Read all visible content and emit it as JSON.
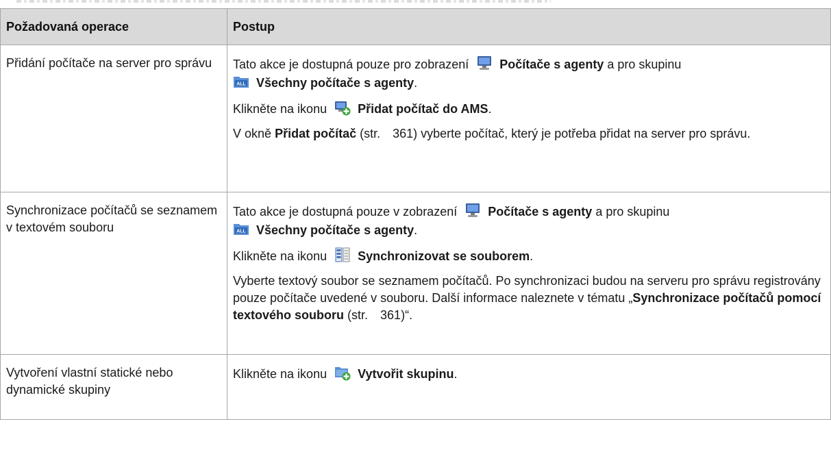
{
  "table": {
    "headers": [
      "Požadovaná operace",
      "Postup"
    ],
    "rows": [
      {
        "operation": "Přidání počítače na server pro správu",
        "p1": {
          "t1": "Tato akce je dostupná pouze pro zobrazení",
          "b1": "Počítače s agenty",
          "t2": "a pro skupinu",
          "b2": "Všechny počítače s agenty",
          "t3": ".",
          "icon1": "computer-icon",
          "icon2": "all-group-folder-icon"
        },
        "p2": {
          "t1": "Klikněte na ikonu",
          "b1": "Přidat počítač do AMS",
          "t2": ".",
          "icon": "add-computer-icon"
        },
        "p3": {
          "t1": "V okně",
          "b1": "Přidat počítač",
          "t2": "(str.",
          "page": "361",
          "t3": ") vyberte počítač, který je potřeba přidat na server pro správu."
        }
      },
      {
        "operation": "Synchronizace počítačů se seznamem v textovém souboru",
        "p1": {
          "t1": "Tato akce je dostupná pouze v zobrazení",
          "b1": "Počítače s agenty",
          "t2": "a pro skupinu",
          "b2": "Všechny počítače s agenty",
          "t3": ".",
          "icon1": "computer-icon",
          "icon2": "all-group-folder-icon"
        },
        "p2": {
          "t1": "Klikněte na ikonu",
          "b1": "Synchronizovat se souborem",
          "t2": ".",
          "icon": "sync-file-icon"
        },
        "p3": {
          "t1": "Vyberte textový soubor se seznamem počítačů. Po synchronizaci budou na serveru pro správu registrovány pouze počítače uvedené v souboru. Další informace naleznete v tématu „",
          "b1": "Synchronizace počítačů pomocí textového souboru",
          "t2": "(str.",
          "page": "361",
          "t3": ")“."
        }
      },
      {
        "operation": "Vytvoření vlastní statické nebo dynamické skupiny",
        "p1": {
          "t1": "Klikněte na ikonu",
          "b1": "Vytvořit skupinu",
          "t2": ".",
          "icon": "create-group-icon"
        }
      }
    ]
  }
}
